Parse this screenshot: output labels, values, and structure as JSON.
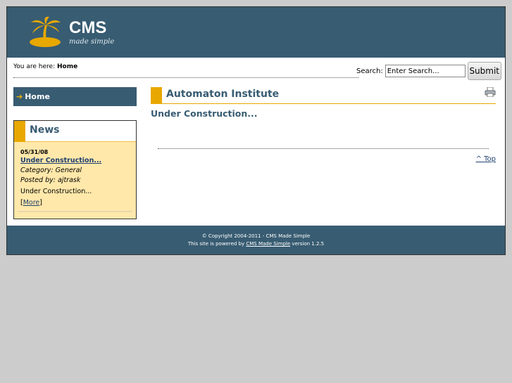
{
  "header": {
    "logo_title": "CMS",
    "logo_tagline": "made simple"
  },
  "breadcrumb": {
    "label": "You are here:",
    "current": "Home"
  },
  "search": {
    "label": "Search:",
    "value": "Enter Search...",
    "button": "Submit"
  },
  "menu": {
    "items": [
      {
        "label": "Home"
      }
    ]
  },
  "news": {
    "heading": "News",
    "items": [
      {
        "date": "05/31/08",
        "title": "Under Construction...",
        "category": "Category: General",
        "posted_by": "Posted by: ajtrask",
        "summary": "Under Construction...",
        "more": "More"
      }
    ]
  },
  "main": {
    "title": "Automaton Institute",
    "subtitle": "Under Construction...",
    "top_link": "^ Top"
  },
  "footer": {
    "copyright": "© Copyright 2004-2011 - CMS Made Simple",
    "powered_prefix": "This site is powered by",
    "powered_link": "CMS Made Simple",
    "powered_suffix": "version 1.2.5"
  },
  "colors": {
    "brand": "#385c72",
    "accent": "#e8a800",
    "news_bg": "#ffe8aa"
  }
}
